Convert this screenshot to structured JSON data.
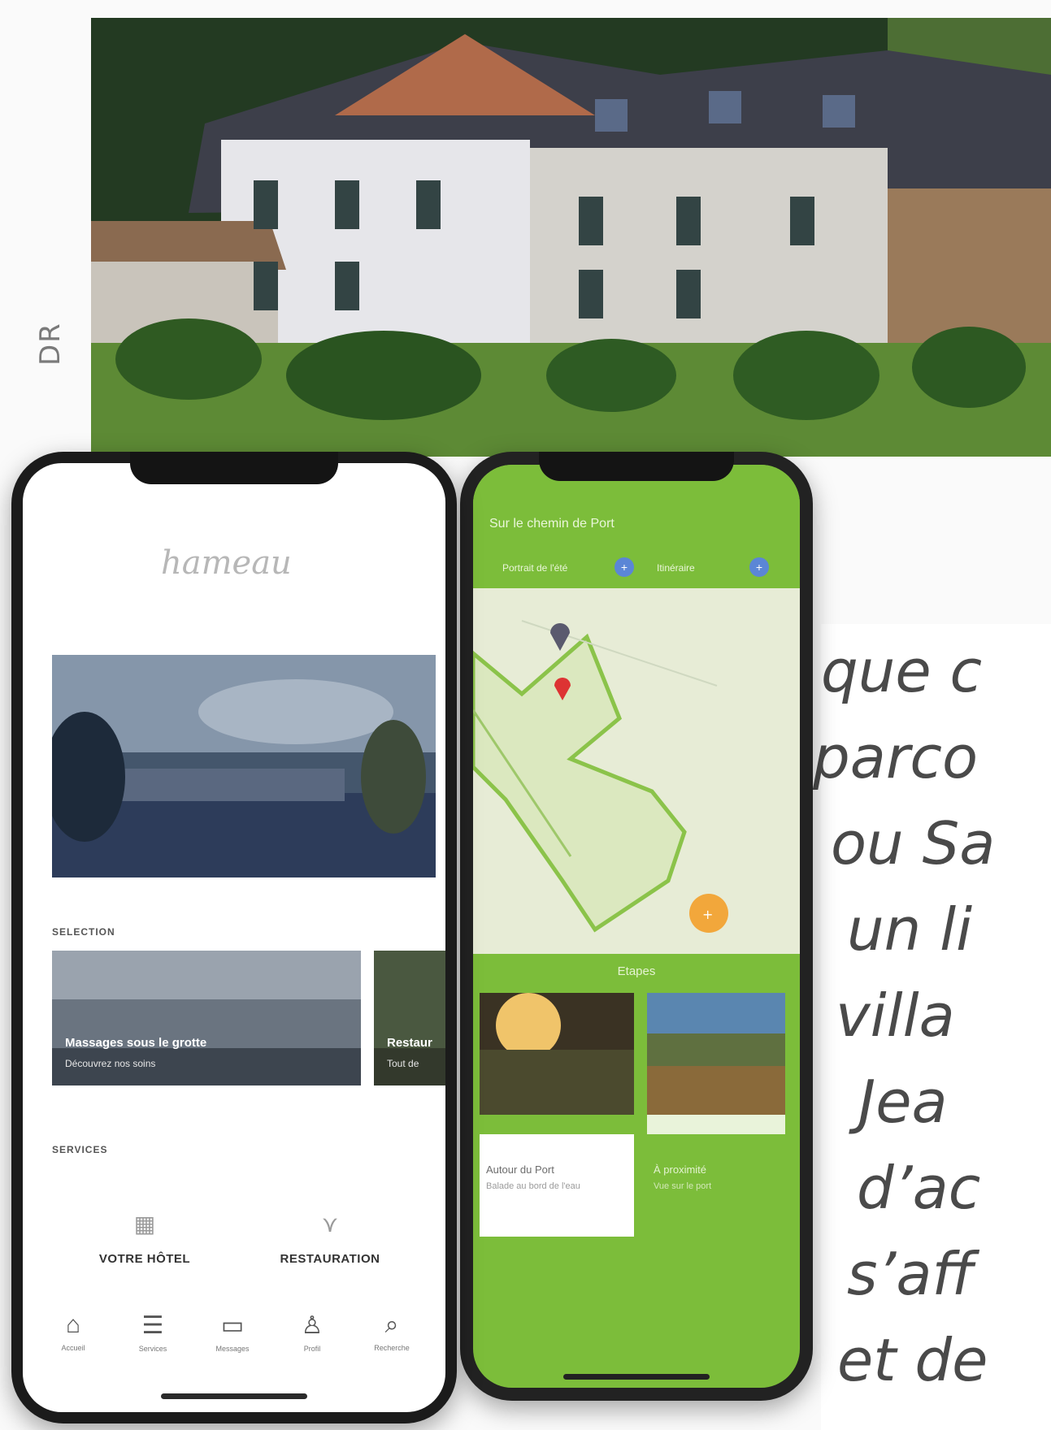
{
  "credit": "DR",
  "colors": {
    "accent_green": "#7cbd3a",
    "phone_frame": "#1b1b1b"
  },
  "article": {
    "lines": [
      "que c",
      "parco",
      "ou Sa",
      "un li",
      "villa",
      "Jea",
      "d’ac",
      "s’aff",
      "et de"
    ]
  },
  "left_app": {
    "logo": "hameau",
    "selection_title": "SELECTION",
    "cards": [
      {
        "title": "Massages sous le grotte",
        "subtitle": "Découvrez nos soins"
      },
      {
        "title": "Restaur",
        "subtitle": "Tout de"
      }
    ],
    "services_title": "SERVICES",
    "services": [
      {
        "label": "VOTRE HÔTEL",
        "icon": "hotel-icon"
      },
      {
        "label": "RESTAURATION",
        "icon": "restaurant-icon"
      }
    ],
    "tabs": [
      {
        "label": "Accueil",
        "icon": "home-icon"
      },
      {
        "label": "Services",
        "icon": "list-icon"
      },
      {
        "label": "Messages",
        "icon": "message-icon"
      },
      {
        "label": "Profil",
        "icon": "user-icon"
      },
      {
        "label": "Recherche",
        "icon": "search-icon"
      }
    ]
  },
  "right_app": {
    "header_title": "Sur le chemin de Port",
    "chip_left": "Portrait de l'été",
    "chip_right": "Itinéraire",
    "section_label": "Etapes",
    "cards": [
      {
        "caption": "Autour du Port",
        "sub": "Balade au bord de l'eau"
      },
      {
        "caption": "À proximité",
        "sub": "Vue sur le port"
      }
    ]
  }
}
